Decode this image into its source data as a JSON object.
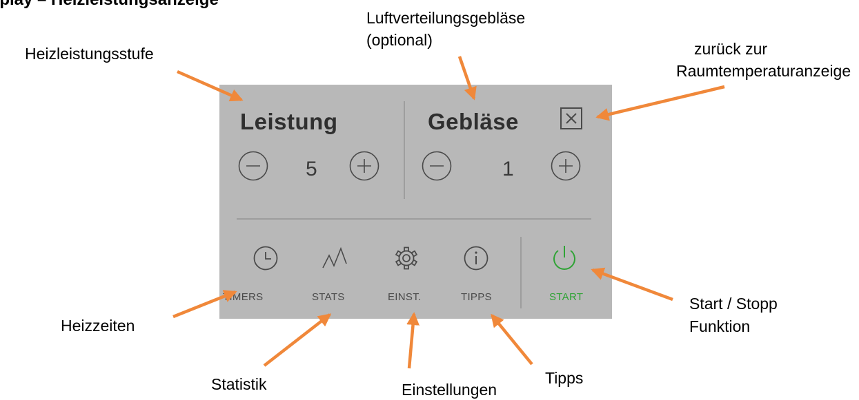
{
  "title": "splay – Heizleistungsanzeige",
  "callouts": {
    "heizleistungsstufe": "Heizleistungsstufe",
    "luftverteilung_line1": "Luftverteilungsgebläse",
    "luftverteilung_line2": "(optional)",
    "zurueck_line1": "zurück zur",
    "zurueck_line2": "Raumtemperaturanzeige",
    "heizzeiten": "Heizzeiten",
    "statistik": "Statistik",
    "einstellungen": "Einstellungen",
    "tipps": "Tipps",
    "startstopp_line1": "Start / Stopp",
    "startstopp_line2": "Funktion"
  },
  "panel": {
    "leistung": {
      "label": "Leistung",
      "value": "5"
    },
    "geblaese": {
      "label": "Gebläse",
      "value": "1"
    },
    "nav": [
      {
        "label": "TIMERS",
        "icon": "clock-icon"
      },
      {
        "label": "STATS",
        "icon": "graph-icon"
      },
      {
        "label": "EINST.",
        "icon": "gear-icon"
      },
      {
        "label": "TIPPS",
        "icon": "info-icon"
      },
      {
        "label": "START",
        "icon": "power-icon"
      }
    ]
  },
  "colors": {
    "panel": "#b8b8b8",
    "arrow": "#f0883a",
    "start": "#2fa335",
    "icon": "#4a4a4a"
  }
}
